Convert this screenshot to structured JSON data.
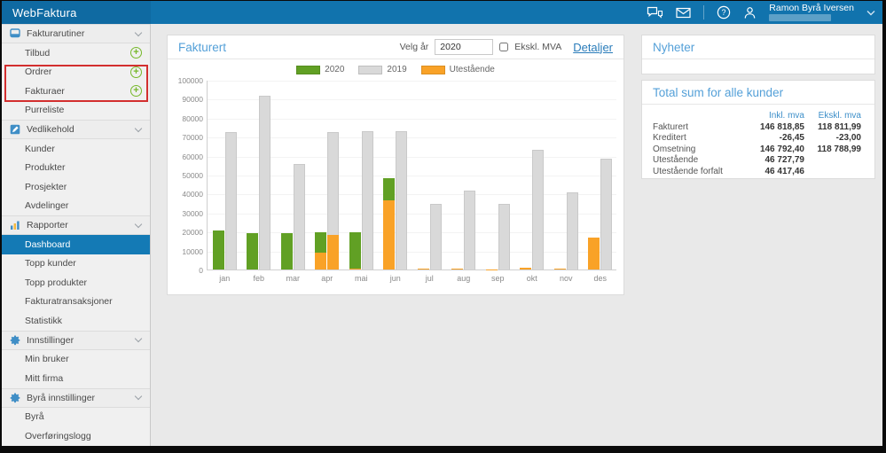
{
  "topbar": {
    "brand": "WebFaktura",
    "user_name": "Ramon Byrå Iversen"
  },
  "sidebar": {
    "sections": [
      {
        "label": "Fakturarutiner",
        "icon": "document-icon",
        "items": [
          {
            "label": "Tilbud",
            "plus": true,
            "annotated": true
          },
          {
            "label": "Ordrer",
            "plus": true,
            "annotated": true
          },
          {
            "label": "Fakturaer",
            "plus": true
          },
          {
            "label": "Purreliste"
          }
        ]
      },
      {
        "label": "Vedlikehold",
        "icon": "edit-icon",
        "items": [
          {
            "label": "Kunder"
          },
          {
            "label": "Produkter"
          },
          {
            "label": "Prosjekter"
          },
          {
            "label": "Avdelinger"
          }
        ]
      },
      {
        "label": "Rapporter",
        "icon": "chart-icon",
        "items": [
          {
            "label": "Dashboard",
            "selected": true
          },
          {
            "label": "Topp kunder"
          },
          {
            "label": "Topp produkter"
          },
          {
            "label": "Fakturatransaksjoner"
          },
          {
            "label": "Statistikk"
          }
        ]
      },
      {
        "label": "Innstillinger",
        "icon": "gear-icon",
        "items": [
          {
            "label": "Min bruker"
          },
          {
            "label": "Mitt firma"
          }
        ]
      },
      {
        "label": "Byrå innstillinger",
        "icon": "gear-icon",
        "items": [
          {
            "label": "Byrå"
          },
          {
            "label": "Overføringslogg"
          }
        ]
      }
    ]
  },
  "chart_card": {
    "title": "Fakturert",
    "year_label": "Velg år",
    "year_value": "2020",
    "checkbox_label": "Ekskl. MVA",
    "details_label": "Detaljer"
  },
  "chart_data": {
    "type": "bar",
    "title": "Fakturert",
    "categories": [
      "jan",
      "feb",
      "mar",
      "apr",
      "mai",
      "jun",
      "jul",
      "aug",
      "sep",
      "okt",
      "nov",
      "des"
    ],
    "series": [
      {
        "name": "2020",
        "color": "#61a024",
        "values": [
          20500,
          19000,
          19200,
          19500,
          19800,
          48000,
          700,
          400,
          200,
          800,
          700,
          17000
        ]
      },
      {
        "name": "2019",
        "color": "#d9d9d9",
        "values": [
          72500,
          91500,
          55500,
          72500,
          72800,
          73000,
          34500,
          41800,
          34500,
          63000,
          40500,
          58500
        ]
      },
      {
        "name": "Utestående",
        "color": "#f9a227",
        "overlay_on_2020": [
          0,
          0,
          0,
          9000,
          500,
          36500,
          700,
          400,
          200,
          800,
          700,
          17000
        ],
        "overlay_on_2019": [
          0,
          0,
          0,
          18000,
          0,
          0,
          0,
          0,
          0,
          0,
          0,
          0
        ]
      }
    ],
    "ylim": [
      0,
      100000
    ],
    "ytick_step": 10000,
    "legend_position": "top",
    "grid": true
  },
  "news_card": {
    "title": "Nyheter"
  },
  "totals_card": {
    "title": "Total sum for alle kunder",
    "columns": [
      "Inkl. mva",
      "Ekskl. mva"
    ],
    "rows": [
      {
        "label": "Fakturert",
        "inkl": "146 818,85",
        "ekskl": "118 811,99"
      },
      {
        "label": "Kreditert",
        "inkl": "-26,45",
        "ekskl": "-23,00"
      },
      {
        "label": "Omsetning",
        "inkl": "146 792,40",
        "ekskl": "118 788,99"
      },
      {
        "label": "Utestående",
        "inkl": "46 727,79",
        "ekskl": ""
      },
      {
        "label": "Utestående forfalt",
        "inkl": "46 417,46",
        "ekskl": ""
      }
    ]
  },
  "annotation": {
    "type": "red-box",
    "around": [
      "Tilbud",
      "Ordrer"
    ]
  },
  "colors": {
    "topbar": "#1173ad",
    "accent_blue": "#54a0d8",
    "link_blue": "#2a7cba",
    "selected_blue": "#147ab5",
    "green": "#61a024",
    "orange": "#f9a227",
    "gray_bar": "#d9d9d9",
    "plus_green": "#76b82a",
    "annotation_red": "#d32f2f"
  }
}
